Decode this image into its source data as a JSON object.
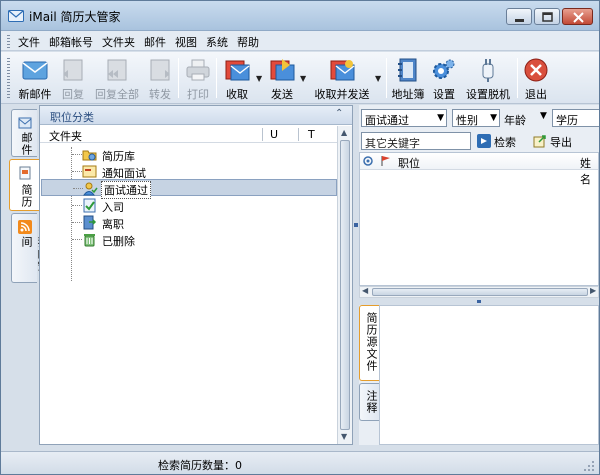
{
  "window": {
    "title": "iMail 简历大管家"
  },
  "menu": [
    "文件",
    "邮箱帐号",
    "文件夹",
    "邮件",
    "视图",
    "系统",
    "帮助"
  ],
  "toolbar": {
    "new_mail": "新邮件",
    "reply": "回复",
    "reply_all": "回复全部",
    "forward": "转发",
    "print": "打印",
    "receive": "收取",
    "send": "发送",
    "send_receive": "收取并发送",
    "address_book": "地址簿",
    "settings": "设置",
    "offline": "设置脱机",
    "exit": "退出"
  },
  "left_tabs": {
    "mail": "邮件",
    "resume": "简历",
    "my_space": "我的空间"
  },
  "folder_panel": {
    "title": "职位分类",
    "col_folder": "文件夹",
    "col_u": "U",
    "col_t": "T",
    "items": [
      "简历库",
      "通知面试",
      "面试通过",
      "入司",
      "离职",
      "已删除"
    ]
  },
  "filters": {
    "status": "面试通过",
    "gender": "性别",
    "age": "年龄",
    "education": "学历"
  },
  "search": {
    "keyword_placeholder": "其它关键字",
    "search_label": "检索",
    "export_label": "导出"
  },
  "list": {
    "col_position": "职位",
    "col_name": "姓名"
  },
  "right_tabs": {
    "source": "简历源文件",
    "notes": "注释"
  },
  "status": {
    "resume_count_label": "检索简历数量：0"
  },
  "colors": {
    "accent": "#2b4e80",
    "selection": "#c6d3e3",
    "tab_highlight": "#e59d2c"
  }
}
